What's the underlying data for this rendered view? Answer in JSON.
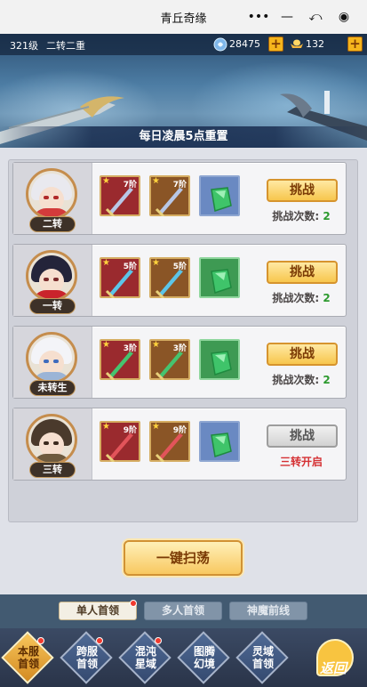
{
  "window": {
    "title": "青丘奇缘",
    "controls": [
      "more-icon",
      "minimize-icon",
      "restore-icon",
      "record-icon"
    ]
  },
  "player": {
    "level": "321级",
    "rank": "二转二重",
    "gems": "28475",
    "coins": "132"
  },
  "notice": "每日凌晨5点重置",
  "challenges": [
    {
      "badge": "二转",
      "items": [
        {
          "grade": "7阶"
        },
        {
          "grade": "7阶"
        }
      ],
      "button": "挑战",
      "count_label": "挑战次数:",
      "count": "2"
    },
    {
      "badge": "一转",
      "items": [
        {
          "grade": "5阶"
        },
        {
          "grade": "5阶"
        }
      ],
      "button": "挑战",
      "count_label": "挑战次数:",
      "count": "2"
    },
    {
      "badge": "未转生",
      "items": [
        {
          "grade": "3阶"
        },
        {
          "grade": "3阶"
        }
      ],
      "button": "挑战",
      "count_label": "挑战次数:",
      "count": "2"
    },
    {
      "badge": "三转",
      "items": [
        {
          "grade": "9阶"
        },
        {
          "grade": "9阶"
        }
      ],
      "button": "挑战",
      "locked_text": "三转开启"
    }
  ],
  "sweep_button": "一键扫荡",
  "sub_tabs": [
    "单人首领",
    "多人首领",
    "神魔前线"
  ],
  "nav": {
    "items": [
      "本服\n首领",
      "跨服\n首领",
      "混沌\n星域",
      "图腾\n幻境",
      "灵域\n首领"
    ],
    "back": "返回"
  },
  "colors": {
    "accent_gold": "#f7c64d",
    "count_green": "#2d9a2f",
    "locked_red": "#d53033",
    "notify_red": "#f03a2e"
  }
}
